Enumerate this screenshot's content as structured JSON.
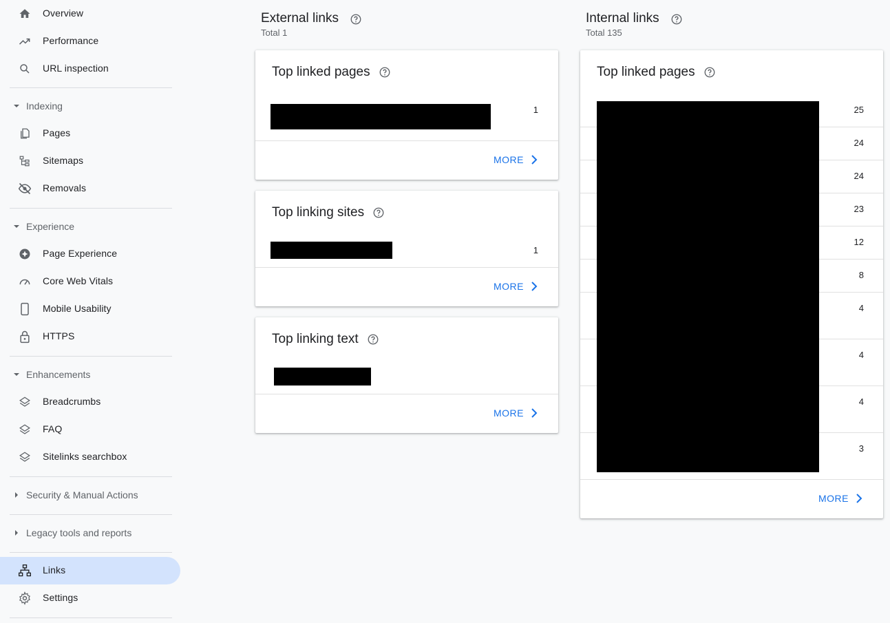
{
  "sidebar": {
    "items": [
      {
        "label": "Overview",
        "icon": "home-icon"
      },
      {
        "label": "Performance",
        "icon": "trending-icon"
      },
      {
        "label": "URL inspection",
        "icon": "search-icon"
      }
    ],
    "sections": [
      {
        "label": "Indexing",
        "items": [
          {
            "label": "Pages",
            "icon": "pages-icon"
          },
          {
            "label": "Sitemaps",
            "icon": "sitemap-icon"
          },
          {
            "label": "Removals",
            "icon": "eye-off-icon"
          }
        ]
      },
      {
        "label": "Experience",
        "items": [
          {
            "label": "Page Experience",
            "icon": "page-experience-icon"
          },
          {
            "label": "Core Web Vitals",
            "icon": "gauge-icon"
          },
          {
            "label": "Mobile Usability",
            "icon": "phone-icon"
          },
          {
            "label": "HTTPS",
            "icon": "lock-icon"
          }
        ]
      },
      {
        "label": "Enhancements",
        "items": [
          {
            "label": "Breadcrumbs",
            "icon": "layers-icon"
          },
          {
            "label": "FAQ",
            "icon": "layers-icon"
          },
          {
            "label": "Sitelinks searchbox",
            "icon": "layers-icon"
          }
        ]
      },
      {
        "label": "Security & Manual Actions"
      },
      {
        "label": "Legacy tools and reports"
      }
    ],
    "bottom_items": [
      {
        "label": "Links",
        "icon": "links-icon",
        "active": true
      },
      {
        "label": "Settings",
        "icon": "gear-icon"
      }
    ]
  },
  "external": {
    "title": "External links",
    "total": "Total 1",
    "cards": [
      {
        "title": "Top linked pages",
        "values": [
          "1"
        ],
        "more": "MORE"
      },
      {
        "title": "Top linking sites",
        "values": [
          "1"
        ],
        "more": "MORE"
      },
      {
        "title": "Top linking text",
        "values": [],
        "more": "MORE"
      }
    ]
  },
  "internal": {
    "title": "Internal links",
    "total": "Total 135",
    "card": {
      "title": "Top linked pages",
      "values": [
        "25",
        "24",
        "24",
        "23",
        "12",
        "8",
        "4",
        "4",
        "4",
        "3"
      ],
      "more": "MORE"
    }
  },
  "colors": {
    "accent": "#1a73e8",
    "active_bg": "#d3e3fd",
    "text": "#202124",
    "muted": "#5f6368"
  }
}
